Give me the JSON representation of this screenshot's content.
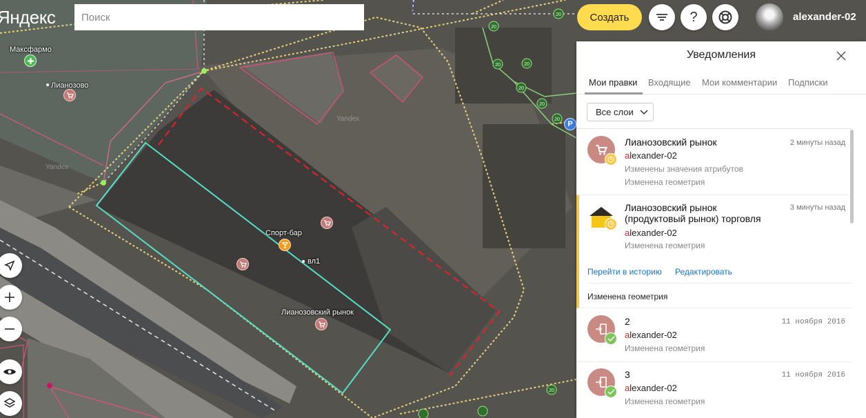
{
  "header": {
    "logo": "Яндекс",
    "search_placeholder": "Поиск",
    "create_label": "Создать",
    "username": "alexander-02",
    "help_glyph": "?"
  },
  "map": {
    "labels": {
      "maksfarmo": "Максфармо",
      "lianozovo": "Лианозово",
      "sport_bar": "Спорт-бар",
      "vl1": "вл1",
      "lianozovsky_market": "Лианозовский рынок",
      "yandex_watermark": "Yandex"
    },
    "road_marker": "20",
    "parking_glyph": "P"
  },
  "left_controls": [
    "navigate-icon",
    "zoom-in-icon",
    "zoom-out-icon",
    "visibility-icon",
    "layers-icon"
  ],
  "panel": {
    "title": "Уведомления",
    "tabs": [
      {
        "label": "Мои правки",
        "active": true
      },
      {
        "label": "Входящие",
        "active": false
      },
      {
        "label": "Мои комментарии",
        "active": false
      },
      {
        "label": "Подписки",
        "active": false
      }
    ],
    "layer_filter": "Все слои",
    "items": [
      {
        "title": "Лианозовский рынок",
        "time": "2 минуты назад",
        "user_first": "a",
        "user_rest": "lexander-02",
        "lines": [
          "Изменены значения атрибутов",
          "Изменена геометрия"
        ]
      },
      {
        "title_line1": "Лианозовский рынок",
        "title_line2": "(продуктовый рынок) торговля",
        "time": "3 минуты назад",
        "user_first": "a",
        "user_rest": "lexander-02",
        "lines": [
          "Изменена геометрия"
        ],
        "actions": [
          "Перейти в историю",
          "Редактировать"
        ],
        "subline": "Изменена геометрия"
      },
      {
        "title": "2",
        "time": "11 ноября 2016",
        "user_first": "a",
        "user_rest": "lexander-02",
        "lines": [
          "Изменена геометрия"
        ]
      },
      {
        "title": "3",
        "time": "11 ноября 2016",
        "user_first": "a",
        "user_rest": "lexander-02",
        "lines": [
          "Изменена геометрия"
        ]
      }
    ]
  },
  "colors": {
    "accent_yellow": "#ffdb4d",
    "selection_cyan": "#4fe0c8",
    "draft_red": "#e02020",
    "link_blue": "#1a73c8"
  }
}
